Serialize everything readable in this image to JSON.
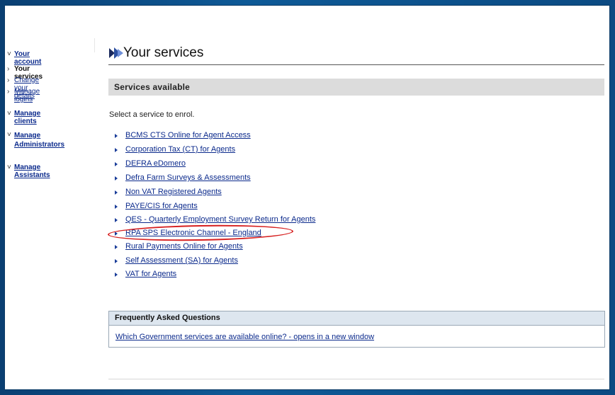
{
  "sidebar": {
    "your_account": "Your account",
    "your_services": "Your services",
    "change_details": "Change your details",
    "manage_logins": "Manage logins",
    "manage_clients": "Manage clients",
    "manage_admins_1": "Manage",
    "manage_admins_2": "Administrators",
    "manage_assistants": "Manage Assistants"
  },
  "header": {
    "title": "Your services"
  },
  "services_section": {
    "heading": "Services available",
    "intro": "Select a service to enrol.",
    "items": [
      {
        "label": "BCMS CTS Online for Agent Access"
      },
      {
        "label": "Corporation Tax (CT) for Agents"
      },
      {
        "label": "DEFRA eDomero"
      },
      {
        "label": "Defra Farm Surveys & Assessments"
      },
      {
        "label": "Non VAT Registered Agents"
      },
      {
        "label": "PAYE/CIS for Agents"
      },
      {
        "label": "QES - Quarterly Employment Survey Return for Agents"
      },
      {
        "label": "RPA SPS Electronic Channel - England"
      },
      {
        "label": "Rural Payments Online for Agents"
      },
      {
        "label": "Self Assessment (SA) for Agents"
      },
      {
        "label": "VAT for Agents"
      }
    ]
  },
  "faq": {
    "title": "Frequently Asked Questions",
    "link": "Which Government services are available online? - opens in a new window"
  },
  "colors": {
    "link": "#0b2a8c",
    "frame": "#0b4f86",
    "annotation": "#d61f1f",
    "section_bar": "#dcdcdc"
  }
}
